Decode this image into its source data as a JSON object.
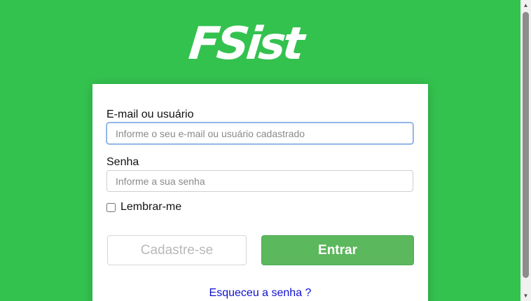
{
  "brand": {
    "logo_text": "FSist"
  },
  "form": {
    "email_label": "E-mail ou usuário",
    "email_placeholder": "Informe o seu e-mail ou usuário cadastrado",
    "password_label": "Senha",
    "password_placeholder": "Informe a sua senha",
    "remember_label": "Lembrar-me",
    "remember_checked": false,
    "register_button": "Cadastre-se",
    "login_button": "Entrar",
    "forgot_link": "Esqueceu a senha ?"
  },
  "colors": {
    "background": "#34c24f",
    "login_button": "#5cb85c",
    "link": "#1010d0"
  },
  "scrollbar": {
    "up_icon": "triangle-up-icon",
    "down_icon": "triangle-down-icon"
  }
}
